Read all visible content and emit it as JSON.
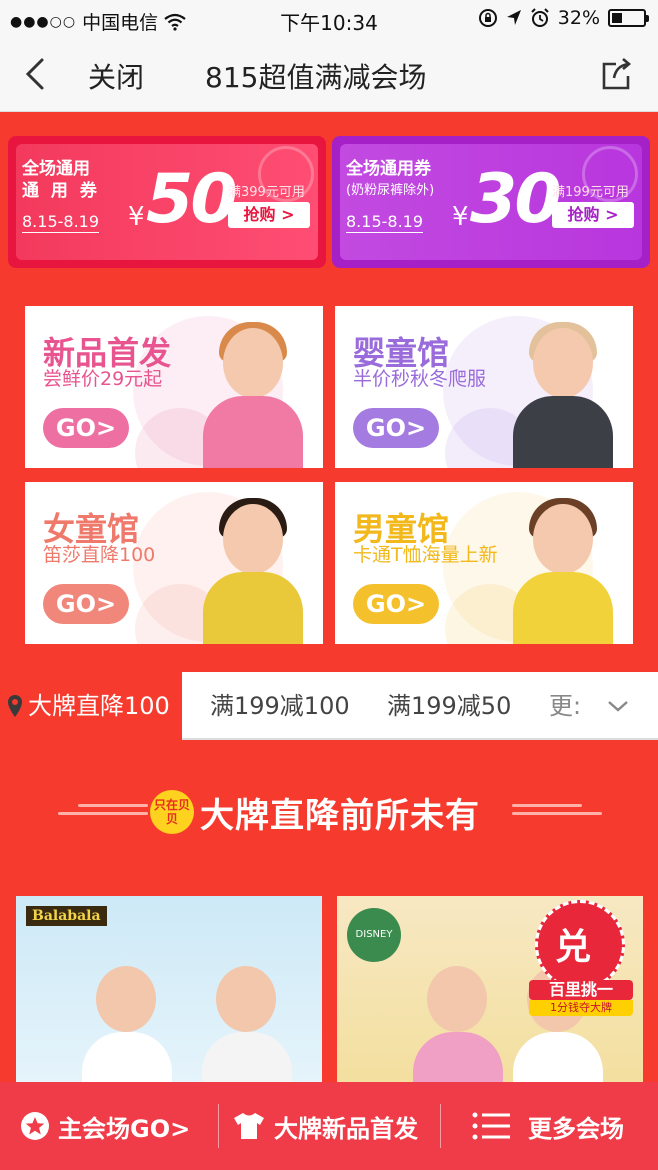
{
  "status_bar": {
    "signal_dots": "●●●○○",
    "carrier": "中国电信",
    "time": "下午10:34",
    "battery": "32%",
    "battery_level": 0.32
  },
  "nav": {
    "close_label": "关闭",
    "title": "815超值满减会场"
  },
  "coupons": [
    {
      "kind": "全场通用",
      "kind_sub": "通 用 券",
      "date": "8.15-8.19",
      "currency": "¥",
      "amount": "50",
      "condition": "满399元可用",
      "button": "抢购 >"
    },
    {
      "kind": "全场通用券",
      "kind_sub": "(奶粉尿裤除外)",
      "date": "8.15-8.19",
      "currency": "¥",
      "amount": "30",
      "condition": "满199元可用",
      "button": "抢购 >"
    }
  ],
  "cards": [
    {
      "title": "新品首发",
      "subtitle": "尝鲜价29元起",
      "go": "GO>",
      "color": "#e8548f"
    },
    {
      "title": "婴童馆",
      "subtitle": "半价秒秋冬爬服",
      "go": "GO>",
      "color": "#9a6bdb"
    },
    {
      "title": "女童馆",
      "subtitle": "笛莎直降100",
      "go": "GO>",
      "color": "#ef7a6b"
    },
    {
      "title": "男童馆",
      "subtitle": "卡通T恤海量上新",
      "go": "GO>",
      "color": "#f2b81c"
    }
  ],
  "tabs": {
    "items": [
      "大牌直降100",
      "满199减100",
      "满199减50",
      "更:"
    ],
    "active_index": 0
  },
  "section": {
    "badge": "只在贝贝",
    "title": "大牌直降前所未有"
  },
  "products": [
    {
      "brand": "Balabala"
    },
    {
      "brand": "DISNEY",
      "promo_main": "百里挑一",
      "promo_sub": "1分钱夺大牌",
      "promo_glyph": "兑"
    }
  ],
  "bottom_bar": {
    "items": [
      "主会场GO>",
      "大牌新品首发",
      "更多会场"
    ]
  },
  "colors": {
    "main_red": "#f63a2e",
    "bottom_bar": "#f03b48",
    "coupon_pink": "#e8163f",
    "coupon_purple": "#a620c7"
  }
}
